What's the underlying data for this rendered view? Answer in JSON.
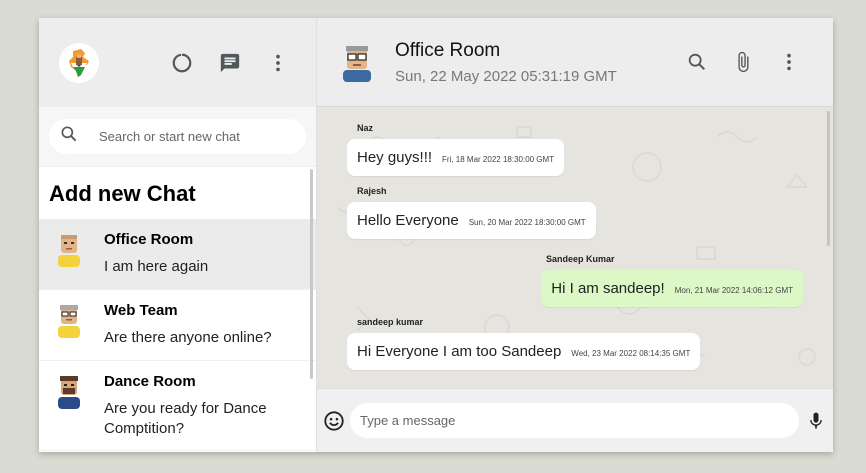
{
  "sidebar": {
    "icons": [
      "status-icon",
      "chat-icon",
      "more-vert-icon"
    ],
    "search": {
      "placeholder": "Search or start new chat"
    },
    "add_chat_label": "Add new Chat",
    "chats": [
      {
        "name": "Office Room",
        "last_message": "I am here again"
      },
      {
        "name": "Web Team",
        "last_message": "Are there anyone online?"
      },
      {
        "name": "Dance Room",
        "last_message": "Are you ready for Dance Comptition?"
      }
    ]
  },
  "chat": {
    "room_name": "Office Room",
    "last_seen": "Sun, 22 May 2022 05:31:19 GMT",
    "header_icons": [
      "search-icon",
      "attach-icon",
      "more-vert-icon"
    ],
    "messages": [
      {
        "sender": "Naz",
        "text": "Hey guys!!!",
        "timestamp": "Fri, 18 Mar 2022 18:30:00 GMT",
        "mine": false
      },
      {
        "sender": "Rajesh",
        "text": "Hello Everyone",
        "timestamp": "Sun, 20 Mar 2022 18:30:00 GMT",
        "mine": false
      },
      {
        "sender": "Sandeep Kumar",
        "text": "Hi I am sandeep!",
        "timestamp": "Mon, 21 Mar 2022 14:06:12 GMT",
        "mine": true
      },
      {
        "sender": "sandeep kumar",
        "text": "Hi Everyone I am too Sandeep",
        "timestamp": "Wed, 23 Mar 2022 08:14:35 GMT",
        "mine": false
      }
    ],
    "footer": {
      "placeholder": "Type a message",
      "icons": [
        "emoji-icon",
        "mic-icon"
      ]
    }
  },
  "colors": {
    "page_bg": "#dadbd3",
    "header_bg": "#ededed",
    "chat_bg": "#e6e4df",
    "outgoing_bubble": "#dcf8c6",
    "incoming_bubble": "#ffffff",
    "icon_gray": "#51585c"
  }
}
